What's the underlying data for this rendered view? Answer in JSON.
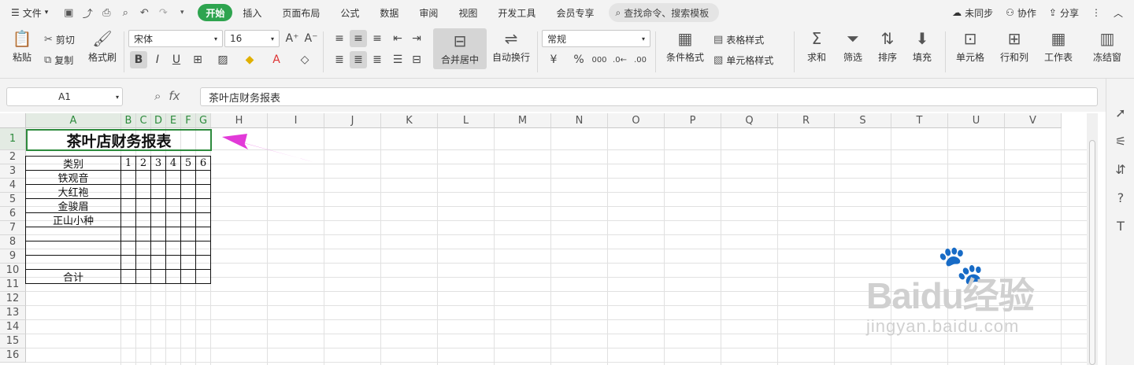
{
  "menubar": {
    "file": "文件",
    "tabs": [
      "开始",
      "插入",
      "页面布局",
      "公式",
      "数据",
      "审阅",
      "视图",
      "开发工具",
      "会员专享"
    ],
    "search": "查找命令、搜索模板",
    "sync": "未同步",
    "collab": "协作",
    "share": "分享"
  },
  "ribbon": {
    "paste": "粘贴",
    "cut": "剪切",
    "copy": "复制",
    "format_painter": "格式刷",
    "font": "宋体",
    "font_size": "16",
    "merge": "合并居中",
    "wrap": "自动换行",
    "number_format": "常规",
    "cond_format": "条件格式",
    "table_style": "表格样式",
    "cell_style": "单元格样式",
    "sum": "求和",
    "filter": "筛选",
    "sort": "排序",
    "fill": "填充",
    "cell": "单元格",
    "rowcol": "行和列",
    "sheet": "工作表",
    "freeze": "冻结窗"
  },
  "formula": {
    "cell_ref": "A1",
    "fx": "fx",
    "content": "茶叶店财务报表"
  },
  "columns": [
    "A",
    "B",
    "C",
    "D",
    "E",
    "F",
    "G",
    "H",
    "I",
    "J",
    "K",
    "L",
    "M",
    "N",
    "O",
    "P",
    "Q",
    "R",
    "S",
    "T",
    "U",
    "V"
  ],
  "rows": [
    "1",
    "2",
    "3",
    "4",
    "5",
    "6",
    "7",
    "8",
    "9",
    "10",
    "11",
    "12",
    "13",
    "14",
    "15",
    "16"
  ],
  "sheet": {
    "title": "茶叶店财务报表",
    "header_label": "类别",
    "day_headers": [
      "1",
      "2",
      "3",
      "4",
      "5",
      "6"
    ],
    "categories": [
      "铁观音",
      "大红袍",
      "金骏眉",
      "正山小种",
      "",
      "",
      ""
    ],
    "total_label": "合计"
  },
  "watermark": {
    "brand": "Baidu经验",
    "url": "jingyan.baidu.com"
  }
}
